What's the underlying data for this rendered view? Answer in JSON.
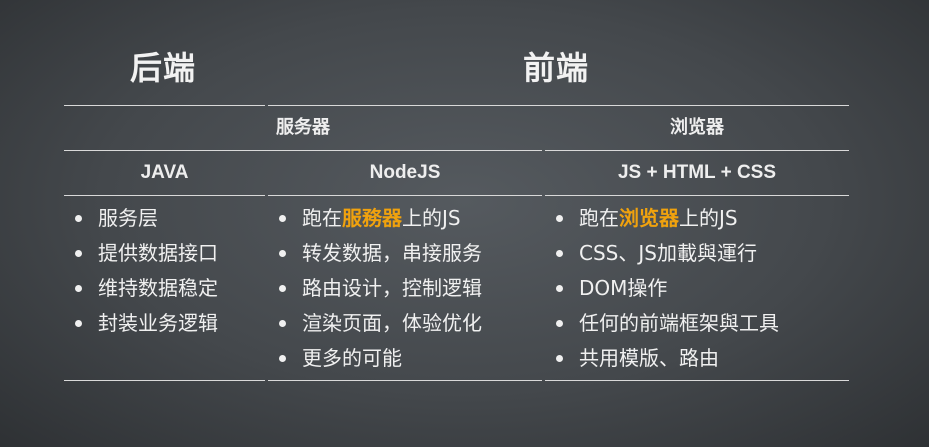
{
  "titles": {
    "backend": "后端",
    "frontend": "前端"
  },
  "header_row1": {
    "server": "服务器",
    "browser": "浏览器"
  },
  "header_row2": {
    "java": "JAVA",
    "nodejs": "NodeJS",
    "frontend_tech": "JS + HTML + CSS"
  },
  "columns": {
    "java": [
      "服务层",
      "提供数据接口",
      "维持数据稳定",
      "封装业务逻辑"
    ],
    "nodejs": {
      "first": {
        "pre": "跑在",
        "highlight": "服務器",
        "post": "上的JS"
      },
      "items": [
        "转发数据，串接服务",
        "路由设计，控制逻辑",
        "渲染页面，体验优化",
        "更多的可能"
      ]
    },
    "frontend": {
      "first": {
        "pre": "跑在",
        "highlight": "浏览器",
        "post": "上的JS"
      },
      "items": [
        "CSS、JS加載與運行",
        "DOM操作",
        "任何的前端框架與工具",
        "共用模版、路由"
      ]
    }
  },
  "colors": {
    "highlight": "#f0a20e",
    "background": "#4a4e52",
    "text": "#eeeeee"
  }
}
